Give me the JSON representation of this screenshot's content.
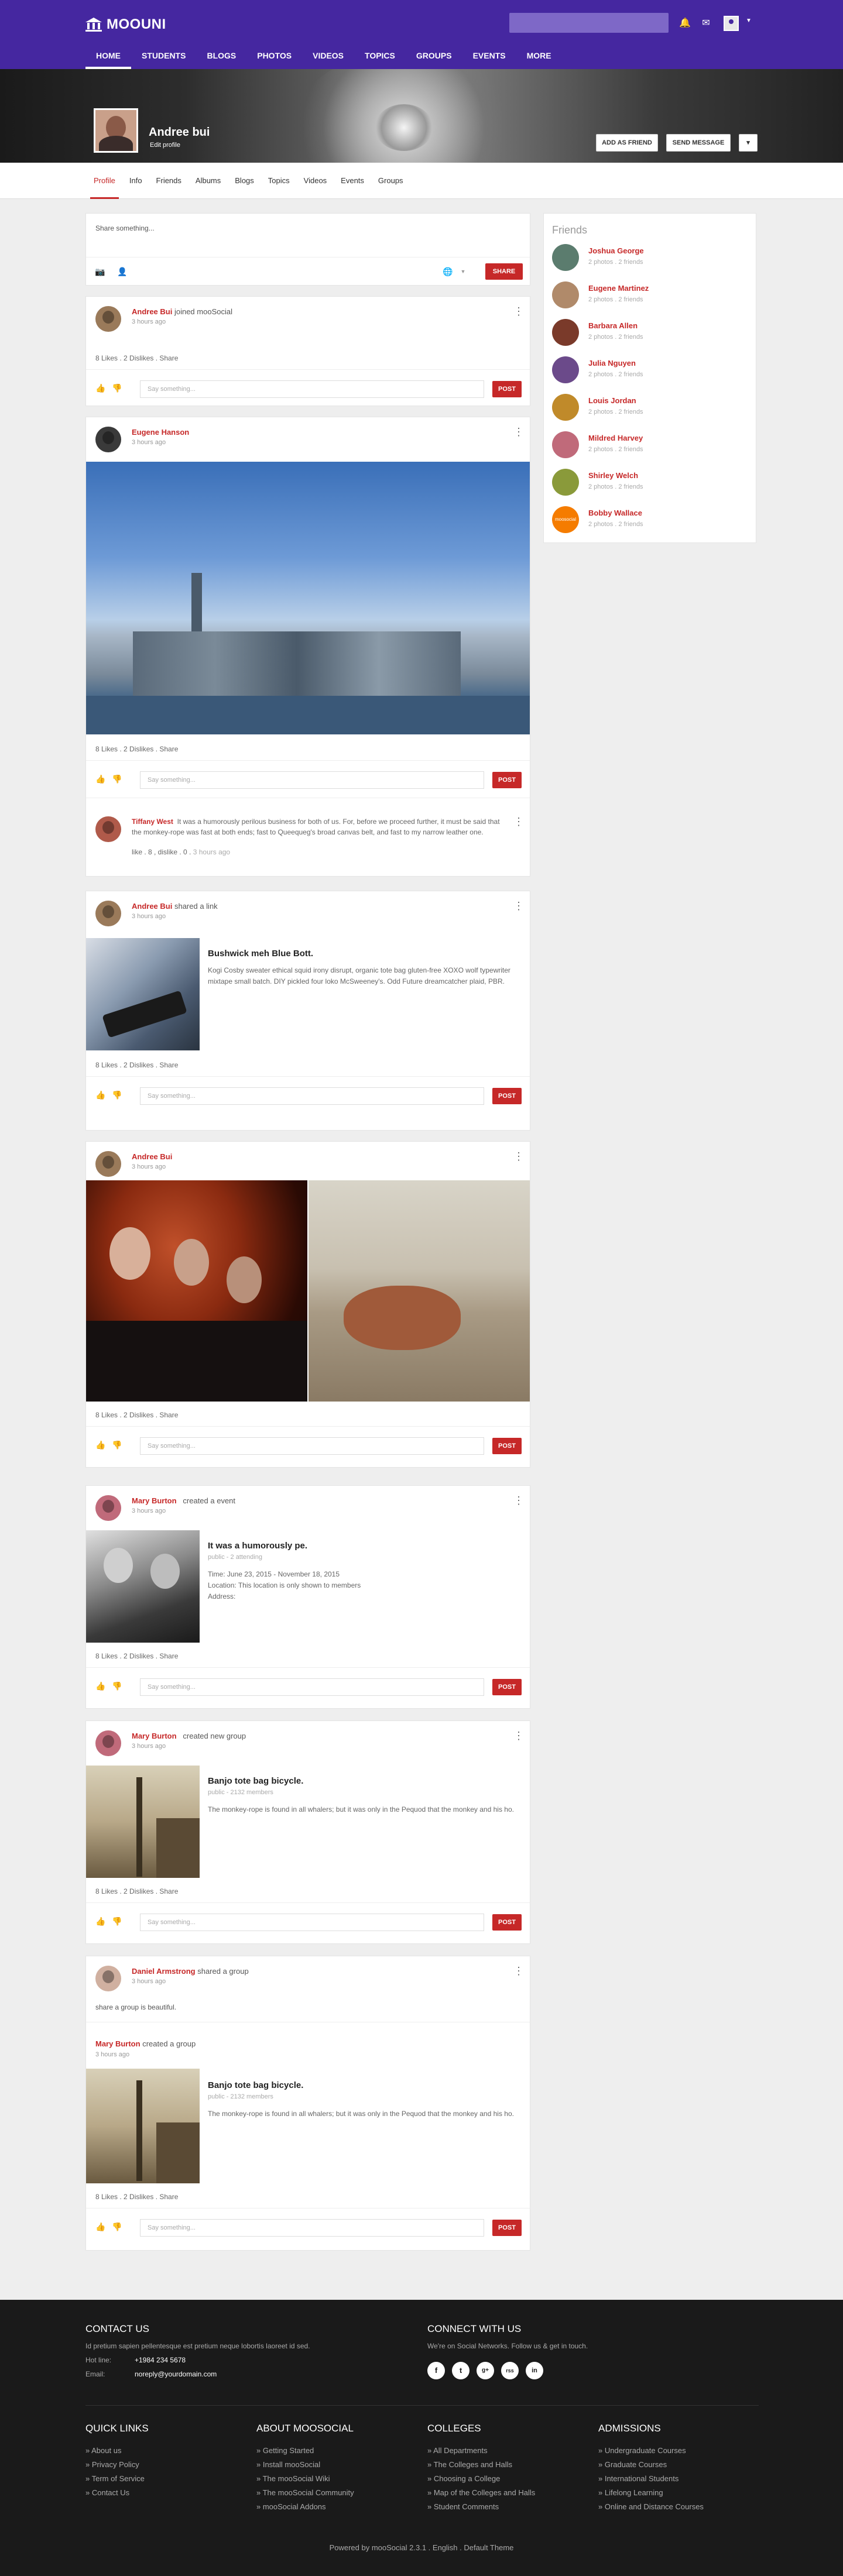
{
  "brand": {
    "name": "MOOUNI",
    "accent": "#4527a0",
    "red": "#c62828"
  },
  "topbar": {
    "search_placeholder": "",
    "nav": [
      "HOME",
      "STUDENTS",
      "BLOGS",
      "PHOTOS",
      "VIDEOS",
      "TOPICS",
      "GROUPS",
      "EVENTS",
      "MORE"
    ],
    "active": "HOME"
  },
  "profile": {
    "name": "Andree bui",
    "edit": "Edit profile",
    "add_friend": "ADD AS FRIEND",
    "send_message": "SEND MESSAGE",
    "more": "▾"
  },
  "tabs": [
    "Profile",
    "Info",
    "Friends",
    "Albums",
    "Blogs",
    "Topics",
    "Videos",
    "Events",
    "Groups"
  ],
  "composer": {
    "placeholder": "Share something...",
    "share": "SHARE"
  },
  "common": {
    "say": "Say something...",
    "post": "POST"
  },
  "feed": [
    {
      "actor": "Andree Bui",
      "action": "joined mooSocial",
      "time": "3 hours ago",
      "stats": "8 Likes . 2 Dislikes . Share"
    },
    {
      "actor": "Eugene Hanson",
      "action": "",
      "time": "3 hours ago",
      "stats": "8 Likes . 2 Dislikes . Share",
      "comment": {
        "author": "Tiffany West",
        "text": "It was a humorously perilous business for both of us. For, before we proceed further, it must be said that the monkey-rope was fast at both ends; fast to Queequeg's broad canvas belt, and fast to my narrow leather one.",
        "meta": "like . 8 , dislike . 0 . ",
        "time": "3 hours ago"
      }
    },
    {
      "actor": "Andree Bui",
      "action": "shared a link",
      "time": "3 hours ago",
      "stats": "8 Likes . 2 Dislikes . Share",
      "link": {
        "title": "Bushwick meh Blue Bott.",
        "desc": "Kogi Cosby sweater ethical squid irony disrupt, organic tote bag gluten-free XOXO wolf typewriter mixtape small batch. DIY pickled four loko McSweeney's. Odd Future dreamcatcher plaid, PBR."
      }
    },
    {
      "actor": "Andree Bui",
      "action": "",
      "time": "3 hours ago",
      "stats": "8 Likes . 2 Dislikes . Share"
    },
    {
      "actor": "Mary Burton",
      "action": "created a event",
      "time": "3 hours ago",
      "stats": "8 Likes . 2 Dislikes . Share",
      "event": {
        "title": "It was a humorously pe.",
        "sub": "public - 2 attending",
        "time": "Time: June 23, 2015 - November 18, 2015",
        "location": "Location: This location is only shown to members",
        "address": "Address:"
      }
    },
    {
      "actor": "Mary Burton",
      "action": "created new group",
      "time": "3 hours ago",
      "stats": "8 Likes . 2 Dislikes . Share",
      "group": {
        "title": "Banjo tote bag bicycle.",
        "sub": "public - 2132 members",
        "desc": "The monkey-rope is found in all whalers; but it was only in the Pequod that the monkey and his ho."
      }
    },
    {
      "actor": "Daniel Armstrong",
      "action": "shared a group",
      "time": "3 hours ago",
      "stats": "8 Likes . 2 Dislikes . Share",
      "note": "share a group is beautiful.",
      "shared": {
        "actor": "Mary Burton",
        "action": "created a group",
        "time": "3 hours ago",
        "title": "Banjo tote bag bicycle.",
        "sub": "public - 2132 members",
        "desc": "The monkey-rope is found in all whalers; but it was only in the Pequod that the monkey and his ho."
      }
    }
  ],
  "friends": {
    "title": "Friends",
    "items": [
      {
        "name": "Joshua George",
        "meta": "2 photos . 2 friends",
        "color": "#5b7c6e"
      },
      {
        "name": "Eugene Martinez",
        "meta": "2 photos . 2 friends",
        "color": "#b08a6a"
      },
      {
        "name": "Barbara Allen",
        "meta": "2 photos . 2 friends",
        "color": "#7a3a2a"
      },
      {
        "name": "Julia Nguyen",
        "meta": "2 photos . 2 friends",
        "color": "#6b4a8a"
      },
      {
        "name": "Louis Jordan",
        "meta": "2 photos . 2 friends",
        "color": "#c08a2a"
      },
      {
        "name": "Mildred Harvey",
        "meta": "2 photos . 2 friends",
        "color": "#c06a7a"
      },
      {
        "name": "Shirley Welch",
        "meta": "2 photos . 2 friends",
        "color": "#8a9a3a"
      },
      {
        "name": "Bobby Wallace",
        "meta": "2 photos . 2 friends",
        "color": "#f57c00",
        "badge": "moosocial"
      }
    ]
  },
  "footer": {
    "contact_title": "CONTACT US",
    "contact_text": "Id pretium sapien pellentesque est pretium neque lobortis laoreet id sed.",
    "hotline_label": "Hot line:",
    "hotline": "+1984 234 5678",
    "email_label": "Email:",
    "email": "noreply@yourdomain.com",
    "connect_title": "CONNECT WITH US",
    "connect_text": "We're on Social Networks. Follow us & get in touch.",
    "social": [
      "f",
      "t",
      "g+",
      "rss",
      "in"
    ],
    "cols": [
      {
        "title": "QUICK LINKS",
        "links": [
          "About us",
          "Privacy Policy",
          "Term of Service",
          "Contact Us"
        ]
      },
      {
        "title": "ABOUT MOOSOCIAL",
        "links": [
          "Getting Started",
          "Install mooSocial",
          "The mooSocial Wiki",
          "The mooSocial Community",
          "mooSocial Addons"
        ]
      },
      {
        "title": "COLLEGES",
        "links": [
          "All Departments",
          "The Colleges and Halls",
          "Choosing a College",
          "Map of the Colleges and Halls",
          "Student Comments"
        ]
      },
      {
        "title": "ADMISSIONS",
        "links": [
          "Undergraduate Courses",
          "Graduate Courses",
          "International Students",
          "Lifelong Learning",
          "Online and Distance Courses"
        ]
      }
    ],
    "copyright": "Powered by mooSocial 2.3.1 .   English  .  Default Theme"
  }
}
